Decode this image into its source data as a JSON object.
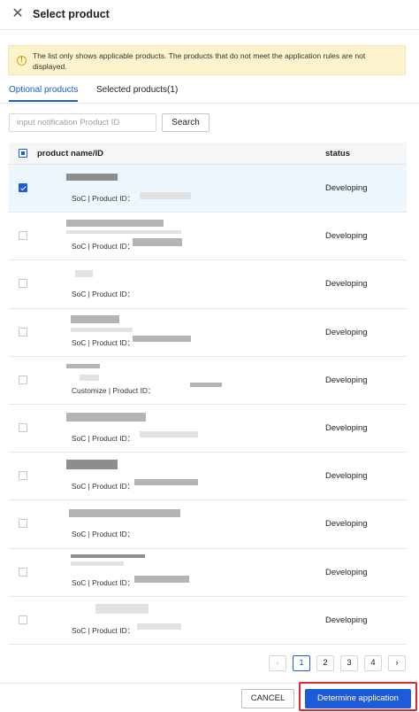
{
  "dialog": {
    "title": "Select product",
    "close_icon": "close-icon"
  },
  "notice": {
    "icon": "info-icon",
    "text": "The list only shows applicable products. The products that do not meet the application rules are not displayed."
  },
  "tabs": [
    {
      "label": "Optional products",
      "active": true
    },
    {
      "label": "Selected products(1)",
      "active": false
    }
  ],
  "search": {
    "placeholder": "input notification Product ID",
    "value": "",
    "button_label": "Search"
  },
  "table": {
    "header_checkbox": "partial",
    "columns": [
      "product name/ID",
      "status"
    ],
    "rows": [
      {
        "selected": true,
        "sub": "SoC | Product ID：",
        "status": "Developing"
      },
      {
        "selected": false,
        "sub": "SoC | Product ID：",
        "status": "Developing"
      },
      {
        "selected": false,
        "sub": "SoC | Product ID：",
        "status": "Developing"
      },
      {
        "selected": false,
        "sub": "SoC | Product ID：",
        "status": "Developing"
      },
      {
        "selected": false,
        "sub": "Customize | Product ID：",
        "status": "Developing"
      },
      {
        "selected": false,
        "sub": "SoC | Product ID：",
        "status": "Developing"
      },
      {
        "selected": false,
        "sub": "SoC | Product ID：",
        "status": "Developing"
      },
      {
        "selected": false,
        "sub": "SoC | Product ID：",
        "status": "Developing"
      },
      {
        "selected": false,
        "sub": "SoC | Product ID：",
        "status": "Developing"
      },
      {
        "selected": false,
        "sub": "SoC | Product ID：",
        "status": "Developing"
      }
    ]
  },
  "pagination": {
    "prev_icon": "chevron-left-icon",
    "next_icon": "chevron-right-icon",
    "pages": [
      "1",
      "2",
      "3",
      "4"
    ],
    "current": "1"
  },
  "footer": {
    "cancel_label": "CANCEL",
    "confirm_label": "Determine application"
  },
  "colors": {
    "accent": "#1e5bd9",
    "notice_bg": "#fdf3cc",
    "highlight": "#e0262e",
    "selected_row_bg": "#eef6fe"
  }
}
